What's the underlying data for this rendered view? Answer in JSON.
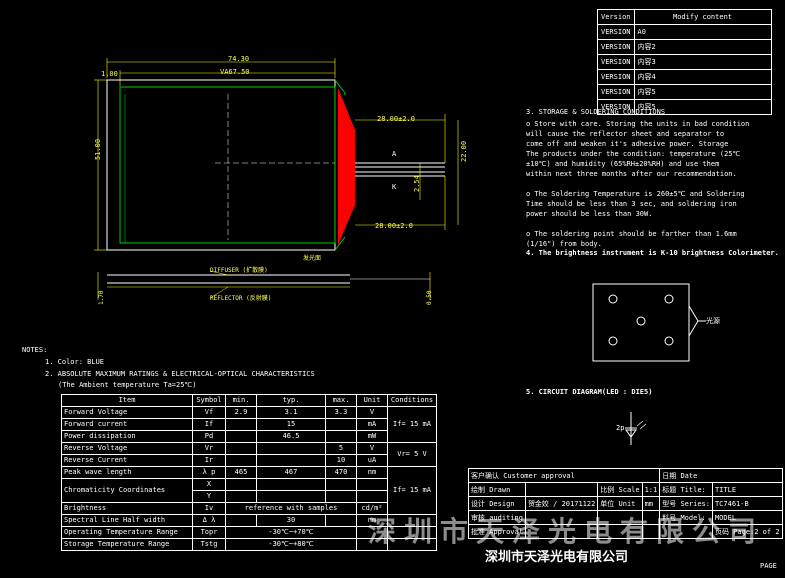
{
  "version_table": {
    "header_version": "Version",
    "header_modify": "Modify content",
    "rows": [
      {
        "version": "VERSION",
        "content": "A0"
      },
      {
        "version": "VERSION",
        "content": "内容2"
      },
      {
        "version": "VERSION",
        "content": "内容3"
      },
      {
        "version": "VERSION",
        "content": "内容4"
      },
      {
        "version": "VERSION",
        "content": "内容5"
      },
      {
        "version": "VERSION",
        "content": "内容5"
      }
    ]
  },
  "drawing": {
    "dim_width": "74.30",
    "dim_va_width": "VA67.50",
    "dim_offset": "1.00",
    "dim_height": "51.00",
    "dim_lead_top": "28.00±2.0",
    "dim_lead_bottom": "28.00±2.0",
    "dim_pitch": "2.54",
    "dim_lead_span": "22.00",
    "label_a": "A",
    "label_k": "K",
    "label_led": "发光面",
    "label_diffuser": "DIFFUSER (扩散膜)",
    "label_reflector": "REFLECTOR (反射膜)",
    "dim_thickness": "1.70",
    "dim_film": "0.50",
    "colors": {
      "led": "#ff0000",
      "panel": "#00cc00",
      "dim": "#ffff00",
      "line": "#ffffff"
    }
  },
  "storage": {
    "title": "3. STORAGE & SOLDERING CONDITIONS",
    "lines": [
      "o Store with care. Storing the units in bad condition",
      "  will  cause  the reflector sheet and  separator  to",
      "  come  off and weaken it's adhesive power. Storage",
      "  The products under the condition: temperature (25℃",
      "  ±10℃) and humidity  (65%RH±20%RH)  and use them",
      "  within  next  three months after our recommendation.",
      "",
      "o The Soldering Temperature is 260±5℃ and Soldering",
      "  Time should  be  less than 3 sec, and soldering iron",
      "  power should be less than 30W.",
      "",
      "o The  soldering  point should  be  farther than 1.6mm",
      "  (1/16\") from body."
    ],
    "brightness_note": "4. The brightness instrument is K-10 brightness Colorimeter."
  },
  "measure": {
    "label": "光源"
  },
  "circuit": {
    "title": "5. CIRCUIT DIAGRAM(LED : DIE5)",
    "node": "2p"
  },
  "notes": {
    "title": "NOTES:",
    "color": "1. Color: BLUE",
    "ratings_title": "2. ABSOLUTE MAXIMUM RATINGS & ELECTRICAL-OPTICAL CHARACTERISTICS",
    "ambient": "(The Ambient temperature Ta=25℃)"
  },
  "spec_table": {
    "headers": [
      "Item",
      "Symbol",
      "min.",
      "typ.",
      "max.",
      "Unit",
      "Conditions"
    ],
    "rows": [
      {
        "item": "Forward Voltage",
        "symbol": "Vf",
        "min": "2.9",
        "typ": "3.1",
        "max": "3.3",
        "unit": "V"
      },
      {
        "item": "Forward current",
        "symbol": "If",
        "min": "",
        "typ": "15",
        "max": "",
        "unit": "mA"
      },
      {
        "item": "Power dissipation",
        "symbol": "Pd",
        "min": "",
        "typ": "46.5",
        "max": "",
        "unit": "mW"
      },
      {
        "item": "Reverse Voltage",
        "symbol": "Vr",
        "min": "",
        "typ": "",
        "max": "5",
        "unit": "V"
      },
      {
        "item": "Reverse Current",
        "symbol": "Ir",
        "min": "",
        "typ": "",
        "max": "10",
        "unit": "uA"
      },
      {
        "item": "Peak wave length",
        "symbol": "λ p",
        "min": "465",
        "typ": "467",
        "max": "470",
        "unit": "nm"
      },
      {
        "item": "Chromaticity Coordinates",
        "symbol_x": "X",
        "symbol_y": "Y"
      },
      {
        "item": "Brightness",
        "symbol": "Iv",
        "merged": "reference with samples",
        "unit": "cd/m²"
      },
      {
        "item": "Spectral Line Half width",
        "symbol": "Δ λ",
        "typ": "30",
        "unit": "nm"
      },
      {
        "item": "Operating Temperature Range",
        "symbol": "Topr",
        "range": "-30℃~+70℃"
      },
      {
        "item": "Storage Temperature Range",
        "symbol": "Tstg",
        "range": "-30℃~+80℃"
      }
    ],
    "cond1": "If= 15  mA",
    "cond2": "Vr= 5  V",
    "cond3": "If= 15  mA"
  },
  "title_block": {
    "customer": "客户确认 Customer approval",
    "date": "日期 Date",
    "drawn": "绘制 Drawn",
    "scale_label": "比例 Scale",
    "scale": "1:1",
    "title_label": "标题 Title:",
    "title": "TITLE",
    "design": "设计 Design",
    "design_by": "贺金姣 / 20171122",
    "unit_label": "单位 Unit",
    "unit": "mm",
    "series_label": "型号 Series:",
    "series": "TC7461-B",
    "auditing": "审核 auditing",
    "approval": "批准 Approval",
    "model_label": "料号 Model:",
    "model": "MODEL",
    "page": "页码 Page:2 of 2",
    "page2": "PAGE",
    "company": "深圳市天泽光电有限公司",
    "watermark": "深圳市天泽光电有限公司"
  }
}
